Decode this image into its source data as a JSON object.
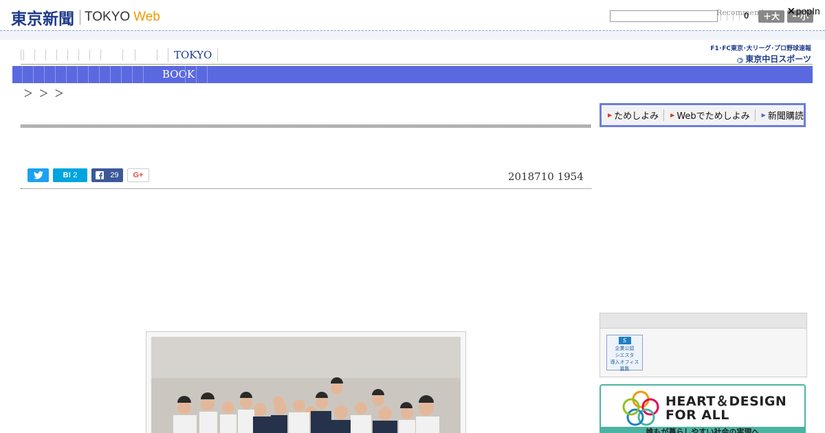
{
  "header": {
    "logo_kanji": "東京新聞",
    "logo_tokyo": "TOKYO",
    "logo_web": "Web",
    "search_value": "",
    "recommend_text": "Recommend",
    "count_text": "0",
    "font_large_label": "＋大",
    "font_small_label": "ー小",
    "popin_x": "✕",
    "popin_label": "popIn"
  },
  "nav": {
    "tokyo_label": "TOKYO",
    "subnav_book_label": "BOOK"
  },
  "chunichi": {
    "tagline": "F1･FC東京･大リーグ･プロ野球速報",
    "name": "東京中日スポーツ"
  },
  "breadcrumb": "＞ ＞ ＞",
  "trial": {
    "links": [
      "ためしよみ",
      "Webでためしよみ",
      "新聞購読"
    ]
  },
  "social": {
    "hatena_label": "B!",
    "hatena_count": "2",
    "facebook_count": "29",
    "gplus_label": "G+"
  },
  "article": {
    "date": "2018710 1954"
  },
  "sidebar": {
    "badge_lines": [
      "企業公認",
      "シエスタ",
      "導入オフィス",
      "募集"
    ],
    "heart_title_1": "HEART＆DESIGN",
    "heart_title_2": "FOR ALL",
    "heart_tagline": "誰もが暮らしやすい社会の実現へ"
  },
  "colors": {
    "brand_blue": "#1d3a8c",
    "web_orange": "#f39800",
    "subnav_bg": "#5b69e0",
    "heart_teal": "#4bb3a1"
  }
}
